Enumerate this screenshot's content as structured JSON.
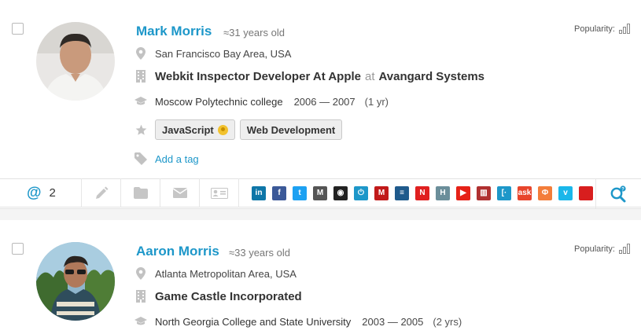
{
  "profiles": [
    {
      "name": "Mark Morris",
      "age": "≈31 years old",
      "location": "San Francisco Bay Area, USA",
      "job": {
        "title": "Webkit Inspector Developer At Apple",
        "at": "at",
        "company": "Avangard Systems"
      },
      "education": {
        "school": "Moscow Polytechnic college",
        "years": "2006 — 2007",
        "duration": "(1 yr)"
      },
      "tags": [
        "JavaScript",
        "Web Development"
      ],
      "add_tag": "Add a tag",
      "popularity_label": "Popularity:",
      "email_count": "2",
      "email_symbol": "@"
    },
    {
      "name": "Aaron Morris",
      "age": "≈33 years old",
      "location": "Atlanta Metropolitan Area, USA",
      "job": {
        "title": "Game Castle Incorporated"
      },
      "education": {
        "school": "North Georgia College and State University",
        "years": "2003 — 2005",
        "duration": "(2 yrs)"
      },
      "popularity_label": "Popularity:"
    }
  ],
  "social_icons": [
    {
      "name": "linkedin-icon",
      "glyph": "in",
      "color": "#0e76a8"
    },
    {
      "name": "facebook-icon",
      "glyph": "f",
      "color": "#3b5998"
    },
    {
      "name": "twitter-icon",
      "glyph": "t",
      "color": "#1da1f2"
    },
    {
      "name": "medium-icon",
      "glyph": "M",
      "color": "#555555"
    },
    {
      "name": "github-icon",
      "glyph": "◉",
      "color": "#222222"
    },
    {
      "name": "power-icon",
      "glyph": "⏻",
      "color": "#1d97c9"
    },
    {
      "name": "meetup-icon",
      "glyph": "M",
      "color": "#c11a1a"
    },
    {
      "name": "stackoverflow-icon",
      "glyph": "≡",
      "color": "#1f5a8c"
    },
    {
      "name": "n-icon",
      "glyph": "N",
      "color": "#e02020"
    },
    {
      "name": "h-icon",
      "glyph": "H",
      "color": "#6b8e9a"
    },
    {
      "name": "youtube-icon",
      "glyph": "▶",
      "color": "#e62117"
    },
    {
      "name": "bars-icon",
      "glyph": "▥",
      "color": "#b03030"
    },
    {
      "name": "bracket-icon",
      "glyph": "[·",
      "color": "#1d97c9"
    },
    {
      "name": "ask-icon",
      "glyph": "ask",
      "color": "#e8452c"
    },
    {
      "name": "phi-icon",
      "glyph": "Ф",
      "color": "#f37d3a"
    },
    {
      "name": "vimeo-icon",
      "glyph": "v",
      "color": "#1ab7ea"
    },
    {
      "name": "red-partial-icon",
      "glyph": "",
      "color": "#d81e1e"
    }
  ],
  "colors": {
    "accent": "#1d97c9",
    "text": "#333333",
    "muted": "#777777"
  }
}
